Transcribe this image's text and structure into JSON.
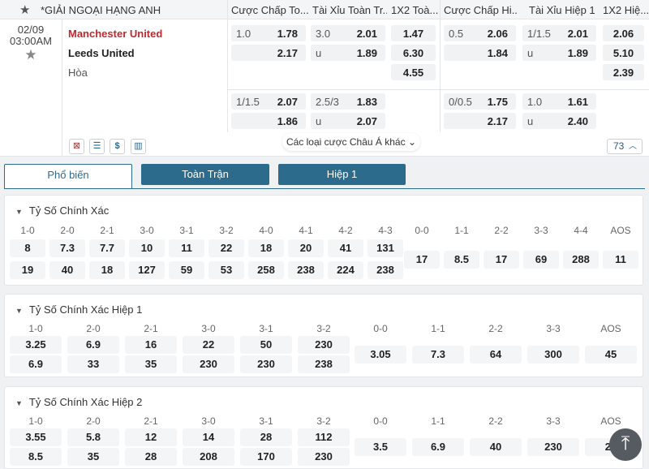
{
  "header": {
    "league": "*GIẢI NGOẠI HẠNG ANH",
    "columns": [
      "Cược Chấp To...",
      "Tài Xỉu Toàn Tr...",
      "1X2 Toà...",
      "Cược Chấp Hi...",
      "Tài Xỉu Hiệp 1",
      "1X2 Hiệ..."
    ]
  },
  "match": {
    "date": "02/09",
    "time": "03:00AM",
    "home": "Manchester United",
    "away": "Leeds United",
    "draw": "Hòa",
    "odds": {
      "hdp_ft_1": {
        "line": "1.0",
        "home": "1.78",
        "away": "2.17"
      },
      "ou_ft_1": {
        "line": "3.0",
        "over": "2.01",
        "under_label": "u",
        "under": "1.89"
      },
      "x12_ft": {
        "home": "1.47",
        "away": "6.30",
        "draw": "4.55"
      },
      "hdp_h1_1": {
        "line": "0.5",
        "home": "2.06",
        "away": "1.84"
      },
      "ou_h1_1": {
        "line": "1/1.5",
        "over": "2.01",
        "under_label": "u",
        "under": "1.89"
      },
      "x12_h1": {
        "home": "2.06",
        "away": "5.10",
        "draw": "2.39"
      },
      "hdp_ft_2": {
        "line": "1/1.5",
        "home": "2.07",
        "away": "1.86"
      },
      "ou_ft_2": {
        "line": "2.5/3",
        "over": "1.83",
        "under_label": "u",
        "under": "2.07"
      },
      "hdp_h1_2": {
        "line": "0/0.5",
        "home": "1.75",
        "away": "2.17"
      },
      "ou_h1_2": {
        "line": "1.0",
        "over": "1.61",
        "under_label": "u",
        "under": "2.40"
      }
    },
    "more_bets": "Các loại cược Châu Á khác",
    "more_count": "73"
  },
  "tabs": {
    "popular": "Phổ biến",
    "full": "Toàn Trận",
    "half1": "Hiệp 1"
  },
  "sections": [
    {
      "title": "Tỷ Số Chính Xác",
      "home_scores": [
        "1-0",
        "2-0",
        "2-1",
        "3-0",
        "3-1",
        "3-2",
        "4-0",
        "4-1",
        "4-2",
        "4-3"
      ],
      "home_odds": [
        "8",
        "7.3",
        "7.7",
        "10",
        "11",
        "22",
        "18",
        "20",
        "41",
        "131"
      ],
      "away_odds": [
        "19",
        "40",
        "18",
        "127",
        "59",
        "53",
        "258",
        "238",
        "224",
        "238"
      ],
      "draw_scores": [
        "0-0",
        "1-1",
        "2-2",
        "3-3",
        "4-4",
        "AOS"
      ],
      "draw_odds": [
        "17",
        "8.5",
        "17",
        "69",
        "288",
        "11"
      ]
    },
    {
      "title": "Tỷ Số Chính Xác Hiệp 1",
      "home_scores": [
        "1-0",
        "2-0",
        "2-1",
        "3-0",
        "3-1",
        "3-2"
      ],
      "home_odds": [
        "3.25",
        "6.9",
        "16",
        "22",
        "50",
        "230"
      ],
      "away_odds": [
        "6.9",
        "33",
        "35",
        "230",
        "230",
        "238"
      ],
      "draw_scores": [
        "0-0",
        "1-1",
        "2-2",
        "3-3",
        "AOS"
      ],
      "draw_odds": [
        "3.05",
        "7.3",
        "64",
        "300",
        "45"
      ]
    },
    {
      "title": "Tỷ Số Chính Xác Hiệp 2",
      "home_scores": [
        "1-0",
        "2-0",
        "2-1",
        "3-0",
        "3-1",
        "3-2"
      ],
      "home_odds": [
        "3.55",
        "5.8",
        "12",
        "14",
        "28",
        "112"
      ],
      "away_odds": [
        "8.5",
        "35",
        "28",
        "208",
        "170",
        "230"
      ],
      "draw_scores": [
        "0-0",
        "1-1",
        "2-2",
        "3-3",
        "AOS"
      ],
      "draw_odds": [
        "3.5",
        "6.9",
        "40",
        "230",
        "20"
      ]
    }
  ]
}
